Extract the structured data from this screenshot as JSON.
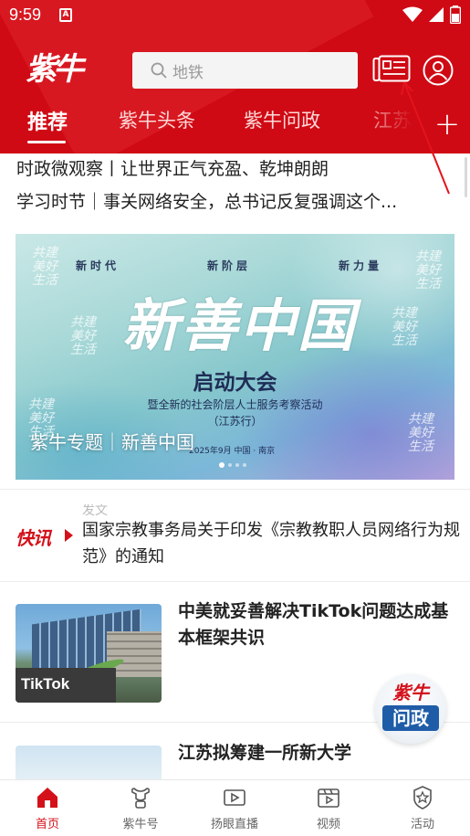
{
  "status_bar": {
    "time": "9:59",
    "notification_badge": "A"
  },
  "header": {
    "logo_text": "紫牛",
    "search_placeholder": "地铁",
    "tabs": [
      {
        "label": "推荐",
        "active": true
      },
      {
        "label": "紫牛头条",
        "active": false
      },
      {
        "label": "紫牛问政",
        "active": false
      },
      {
        "label": "江苏",
        "active": false
      }
    ],
    "add_tab_label": "+"
  },
  "headlines": [
    "时政微观察丨让世界正气充盈、乾坤朗朗",
    "学习时节｜事关网络安全，总书记反复强调这个..."
  ],
  "banner": {
    "subtitles": [
      "新时代",
      "新阶层",
      "新力量"
    ],
    "side_text": "共建美好生活",
    "title": "新善中国",
    "kicker": "启动大会",
    "description": "暨全新的社会阶层人士服务考察活动",
    "description_2": "（江苏行）",
    "date": "2025年9月  中国 · 南京",
    "caption": "紫牛专题｜新善中国",
    "slide_count": 4,
    "active_slide": 0
  },
  "flash": {
    "logo_text": "快讯",
    "ghost_text": "发文",
    "text": "国家宗教事务局关于印发《宗教教职人员网络行为规范》的通知"
  },
  "articles": [
    {
      "title": "中美就妥善解决TikTok问题达成基本框架共识",
      "thumb_brand": "TikTok"
    },
    {
      "title": "江苏拟筹建一所新大学"
    }
  ],
  "float_badge": {
    "top": "紫牛",
    "bottom": "问政"
  },
  "bottom_nav": [
    {
      "label": "首页",
      "active": true
    },
    {
      "label": "紫牛号",
      "active": false
    },
    {
      "label": "扬眼直播",
      "active": false
    },
    {
      "label": "视频",
      "active": false
    },
    {
      "label": "活动",
      "active": false
    }
  ],
  "colors": {
    "brand_red": "#cf0a14",
    "active_red": "#d4111b",
    "dark_blue": "#1f2d56"
  }
}
